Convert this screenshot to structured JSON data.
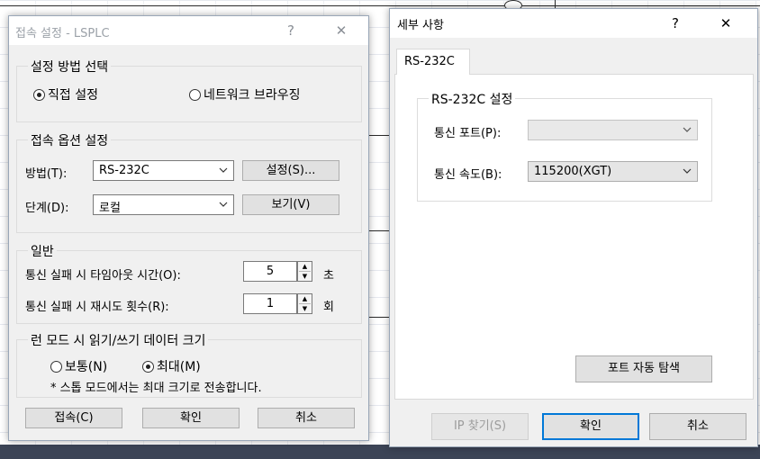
{
  "dialog_connect": {
    "title": "접속 설정 - LSPLC",
    "help_glyph": "?",
    "close_glyph": "✕",
    "method_group": {
      "label": "설정 방법 선택",
      "direct": "직접 설정",
      "network": "네트워크 브라우징",
      "selected": "direct"
    },
    "options_group": {
      "label": "접속 옵션 설정",
      "method_label": "방법(T):",
      "method_value": "RS-232C",
      "settings_button": "설정(S)...",
      "step_label": "단계(D):",
      "step_value": "로컬",
      "view_button": "보기(V)"
    },
    "general_group": {
      "label": "일반",
      "timeout_label": "통신 실패 시 타임아웃 시간(O):",
      "timeout_value": "5",
      "timeout_unit": "초",
      "retry_label": "통신 실패 시 재시도 횟수(R):",
      "retry_value": "1",
      "retry_unit": "회"
    },
    "size_group": {
      "label": "런 모드 시 읽기/쓰기 데이터 크기",
      "normal": "보통(N)",
      "max": "최대(M)",
      "selected": "max",
      "note": "* 스톱 모드에서는 최대 크기로 전송합니다."
    },
    "buttons": {
      "connect": "접속(C)",
      "ok": "확인",
      "cancel": "취소"
    }
  },
  "dialog_details": {
    "title": "세부 사항",
    "help_glyph": "?",
    "close_glyph": "✕",
    "tab_label": "RS-232C",
    "group_label": "RS-232C 설정",
    "port_label": "통신 포트(P):",
    "port_value": "",
    "speed_label": "통신 속도(B):",
    "speed_value": "115200(XGT)",
    "auto_detect_button": "포트 자동 탐색",
    "buttons": {
      "ip_search": "IP 찾기(S)",
      "ok": "확인",
      "cancel": "취소"
    }
  },
  "colors": {
    "dialog_bg": "#f0f0f0",
    "primary_border": "#0078d7",
    "inactive_title": "#9ba1a8"
  }
}
